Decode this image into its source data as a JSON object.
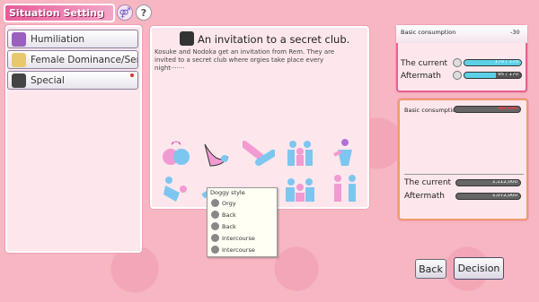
{
  "header": {
    "title": "Situation Setting",
    "gender_icon": "gender-icon",
    "help_icon": "help-icon"
  },
  "categories": [
    {
      "label": "Humiliation",
      "icon": "humiliation-icon"
    },
    {
      "label": "Female Dominance/Ser",
      "icon": "female-dominance-icon"
    },
    {
      "label": "Special",
      "icon": "special-icon"
    }
  ],
  "situation": {
    "title": "An invitation to a secret club.",
    "description": "Kosuke and Nodoka get an invitation from Rem. They are invited to a secret club where orgies take place every night·······"
  },
  "icons": [
    "heart-couple-icon",
    "pose-icon",
    "touch-icon",
    "group-icon",
    "figure-icon",
    "grab-icon",
    "lying-icon",
    "icon-hidden",
    "group-kneel-icon",
    "standing-pair-icon"
  ],
  "popup": {
    "header": "Doggy style",
    "items": [
      "Orgy",
      "Back",
      "Back",
      "Intercourse",
      "Intercourse"
    ]
  },
  "stats_top": {
    "label": "Basic consumption",
    "value": "-30",
    "current_label": "The current",
    "current_value": "170 / 170",
    "current_fill": 1.0,
    "aftermath_label": "Aftermath",
    "aftermath_value": "95 / 170",
    "aftermath_fill": 0.56
  },
  "stats_bottom": {
    "label": "Basic consumption",
    "value": "-40,000",
    "current_label": "The current",
    "current_value": "1,112,000",
    "aftermath_label": "Aftermath",
    "aftermath_value": "1,072,000"
  },
  "buttons": {
    "back": "Back",
    "decision": "Decision"
  }
}
